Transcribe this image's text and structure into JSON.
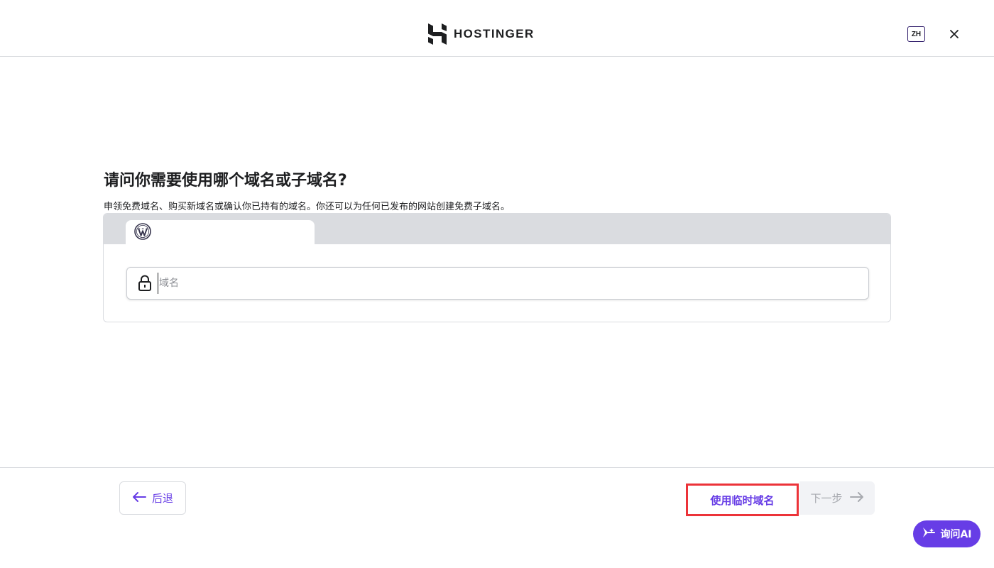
{
  "header": {
    "brand": "HOSTINGER",
    "language": "ZH",
    "logo_icon": "hostinger-logo-icon",
    "close_icon": "close-icon"
  },
  "main": {
    "title": "请问你需要使用哪个域名或子域名?",
    "subtitle": "申领免费域名、购买新域名或确认你已持有的域名。你还可以为任何已发布的网站创建免费子域名。",
    "tab_icon": "wordpress-icon",
    "domain_input": {
      "placeholder": "域名",
      "value": "",
      "icon": "lock-icon"
    }
  },
  "footer": {
    "back_label": "后退",
    "temp_domain_label": "使用临时域名",
    "next_label": "下一步",
    "ask_ai_label": "询问AI"
  },
  "colors": {
    "accent": "#673de6",
    "highlight_border": "#ec3339",
    "tab_bar": "#dadce0",
    "disabled_text": "#a8aab0"
  }
}
